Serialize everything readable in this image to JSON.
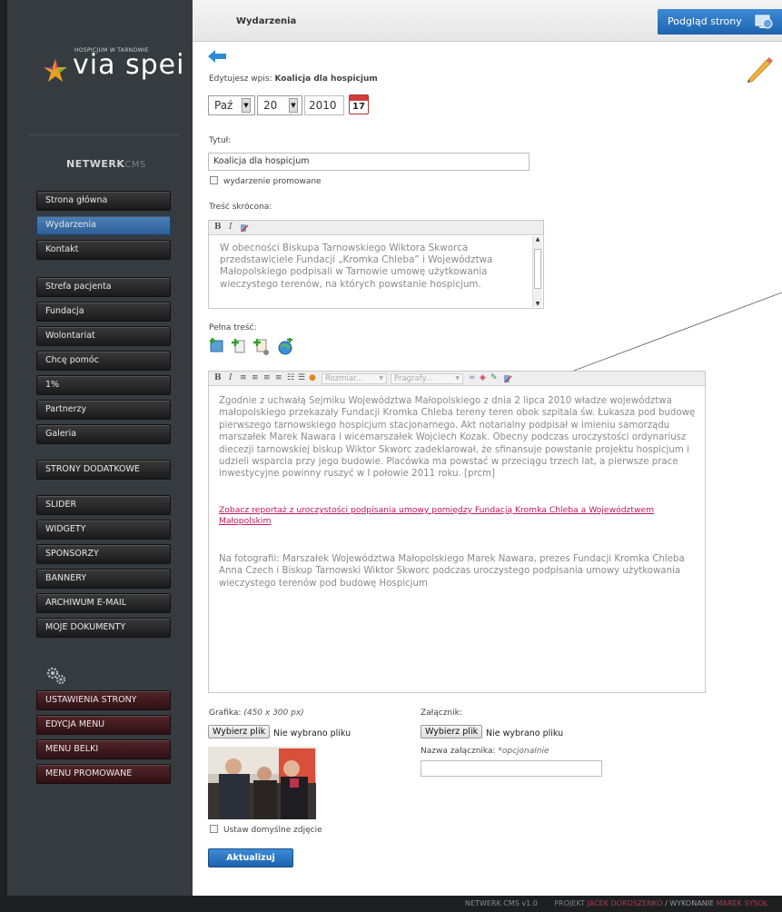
{
  "brand": {
    "subtitle": "HOSPICJUM W TARNOWIE",
    "name": "via spei",
    "cms": "NETWERK",
    "cms_suffix": "CMS"
  },
  "header": {
    "title": "Wydarzenia",
    "preview_button": "Podgląd strony"
  },
  "colors": {
    "accent": "#2d6fb3",
    "active_nav": "#3a70a8",
    "link": "#c0185a"
  },
  "sidebar": {
    "main": [
      "Strona główna",
      "Wydarzenia",
      "Kontakt"
    ],
    "section2": [
      "Strefa pacjenta",
      "Fundacja",
      "Wolontariat",
      "Chcę pomóc",
      "1%",
      "Partnerzy",
      "Galeria"
    ],
    "extra": "STRONY DODATKOWE",
    "section3": [
      "SLIDER",
      "WIDGETY",
      "SPONSORZY",
      "BANNERY",
      "ARCHIWUM E-MAIL",
      "MOJE DOKUMENTY"
    ],
    "settings": [
      "USTAWIENIA STRONY",
      "EDYCJA MENU",
      "MENU BELKI",
      "MENU PROMOWANE"
    ]
  },
  "form": {
    "editing_label": "Edytujesz wpis:",
    "editing_title": "Koalicja dla hospicjum",
    "date": {
      "month": "Paź",
      "day": "20",
      "year": "2010",
      "calendar_day": "17"
    },
    "title_label": "Tytuł:",
    "title_value": "Koalicja dla hospicjum",
    "promoted_label": "wydarzenie promowane",
    "short_label": "Treść skrócona:",
    "short_text": "W obecności Biskupa Tarnowskiego Wiktora Skworca przedstawiciele Fundacji „Kromka Chleba” i Województwa Małopolskiego podpisali w Tarnowie umowę użytkowania wieczystego terenów, na których powstanie hospicjum.",
    "full_label": "Pełna treść:",
    "toolbar": {
      "size": "Rozmiar...",
      "format": "Pragrafy..."
    },
    "full_text_p1": "Zgodnie z uchwałą Sejmiku Województwa Małopolskiego z dnia 2 lipca 2010 władze województwa małopolskiego przekazały Fundacji Kromka Chleba tereny teren obok szpitala św. Łukasza pod budowę pierwszego tarnowskiego hospicjum stacjonarnego. Akt notarialny podpisał w imieniu samorządu marszałek Marek Nawara i wicemarszałek Wojciech Kozak. Obecny podczas uroczystości ordynariusz diecezji tarnowskiej biskup Wiktor Skworc zadeklarował, że sfinansuje powstanie projektu hospicjum i udzieli wsparcia przy jego budowie. Placówka ma powstać w przeciągu trzech lat, a pierwsze prace inwestycyjne powinny ruszyć w I połowie 2011 roku. [prcm]",
    "full_link": "Zobacz reportaż z uroczystości podpisania umowy pomiędzy Fundacją Kromka Chleba a Województwem Małopolskim",
    "full_text_p2": "Na fotografii: Marszałek Województwa Małopolskiego Marek Nawara, prezes Fundacji Kromka Chleba Anna Czech i Biskup Tarnowski Wiktor Skworc podczas uroczystego podpisania umowy użytkowania wieczystego terenów pod budowę Hospicjum",
    "image_label": "Grafika:",
    "image_hint": "(450 x 300 px)",
    "choose_file": "Wybierz plik",
    "no_file": "Nie wybrano pliku",
    "attachment_label": "Załącznik:",
    "attachment_name_label": "Nazwa załącznika:",
    "attachment_name_hint": "*opcjonalnie",
    "default_photo_label": "Ustaw domyślne zdjęcie",
    "submit": "Aktualizuj"
  },
  "footer": {
    "cms": "NETWERK CMS v1.0",
    "project_label": "PROJEKT",
    "project_author": "JACEK DOROSZENKO",
    "impl_label": "/ WYKONANIE",
    "impl_author": "MAREK SYSOŁ"
  }
}
